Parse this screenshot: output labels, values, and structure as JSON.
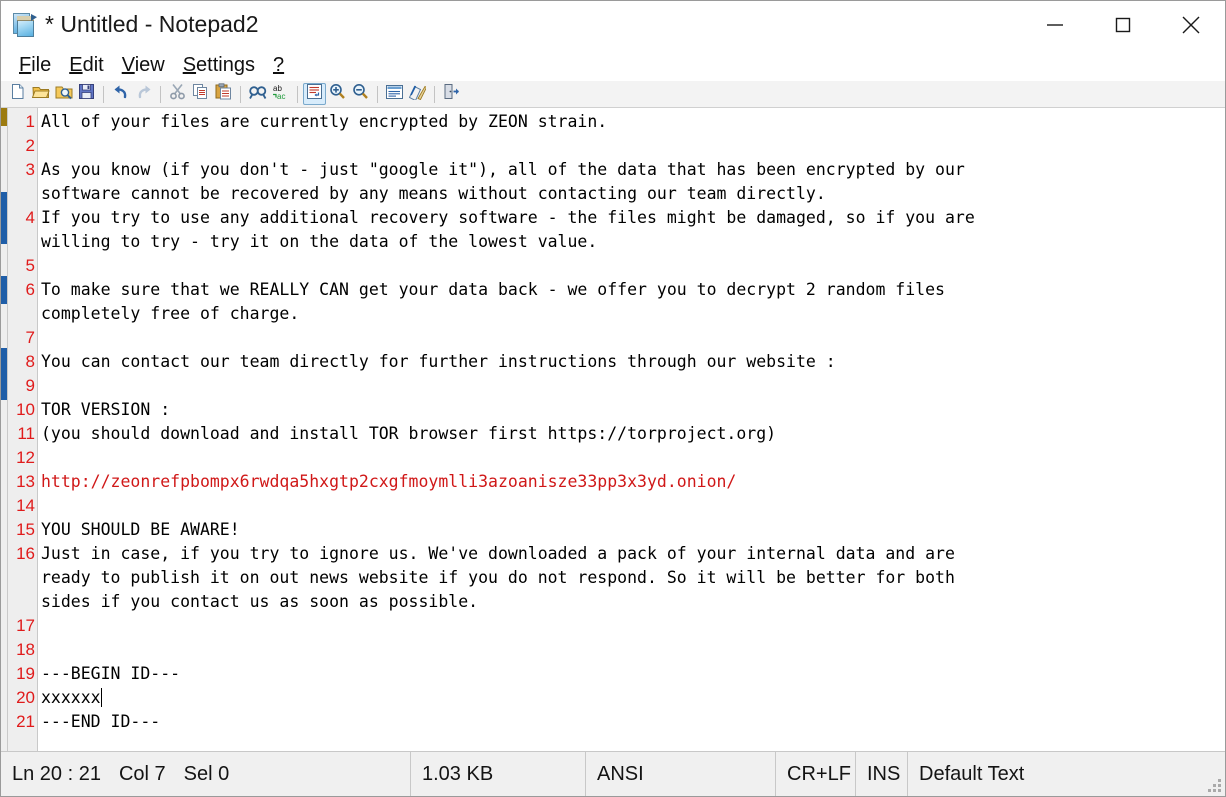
{
  "window": {
    "title": "* Untitled - Notepad2",
    "icon": "notepad-icon",
    "controls": {
      "minimize": "minimize-icon",
      "maximize": "maximize-icon",
      "close": "close-icon"
    }
  },
  "menubar": {
    "items": [
      {
        "label": "File",
        "accel": "F"
      },
      {
        "label": "Edit",
        "accel": "E"
      },
      {
        "label": "View",
        "accel": "V"
      },
      {
        "label": "Settings",
        "accel": "S"
      },
      {
        "label": "?",
        "accel": "?"
      }
    ]
  },
  "toolbar": {
    "buttons": [
      {
        "name": "new-file-icon",
        "title": "New"
      },
      {
        "name": "open-file-icon",
        "title": "Open"
      },
      {
        "name": "browse-file-icon",
        "title": "Browse"
      },
      {
        "name": "save-file-icon",
        "title": "Save"
      },
      {
        "name": "separator",
        "title": ""
      },
      {
        "name": "undo-icon",
        "title": "Undo"
      },
      {
        "name": "redo-icon",
        "title": "Redo"
      },
      {
        "name": "separator",
        "title": ""
      },
      {
        "name": "cut-icon",
        "title": "Cut"
      },
      {
        "name": "copy-icon",
        "title": "Copy"
      },
      {
        "name": "paste-icon",
        "title": "Paste"
      },
      {
        "name": "separator",
        "title": ""
      },
      {
        "name": "find-icon",
        "title": "Find"
      },
      {
        "name": "replace-icon",
        "title": "Replace"
      },
      {
        "name": "separator",
        "title": ""
      },
      {
        "name": "word-wrap-icon",
        "title": "Word Wrap",
        "active": true
      },
      {
        "name": "zoom-in-icon",
        "title": "Zoom In"
      },
      {
        "name": "zoom-out-icon",
        "title": "Zoom Out"
      },
      {
        "name": "separator",
        "title": ""
      },
      {
        "name": "scheme-icon",
        "title": "Scheme"
      },
      {
        "name": "scheme-options-icon",
        "title": "Scheme Options"
      },
      {
        "name": "separator",
        "title": ""
      },
      {
        "name": "exit-icon",
        "title": "Exit"
      }
    ]
  },
  "editor": {
    "line_numbers": [
      "1",
      "2",
      "3",
      "",
      "4",
      "",
      "5",
      "6",
      "",
      "7",
      "8",
      "9",
      "10",
      "11",
      "12",
      "13",
      "14",
      "15",
      "16",
      "",
      "",
      "17",
      "18",
      "19",
      "20",
      "21"
    ],
    "lines": [
      {
        "n": "1",
        "text": "All of your files are currently encrypted by ZEON strain."
      },
      {
        "n": "2",
        "text": ""
      },
      {
        "n": "3",
        "text": "As you know (if you don't - just \"google it\"), all of the data that has been encrypted by our"
      },
      {
        "n": "",
        "text": "software cannot be recovered by any means without contacting our team directly."
      },
      {
        "n": "4",
        "text": "If you try to use any additional recovery software - the files might be damaged, so if you are"
      },
      {
        "n": "",
        "text": "willing to try - try it on the data of the lowest value."
      },
      {
        "n": "5",
        "text": ""
      },
      {
        "n": "6",
        "text": "To make sure that we REALLY CAN get your data back - we offer you to decrypt 2 random files"
      },
      {
        "n": "",
        "text": "completely free of charge."
      },
      {
        "n": "7",
        "text": ""
      },
      {
        "n": "8",
        "text": "You can contact our team directly for further instructions through our website :"
      },
      {
        "n": "9",
        "text": ""
      },
      {
        "n": "10",
        "text": "TOR VERSION :"
      },
      {
        "n": "11",
        "text": "(you should download and install TOR browser first https://torproject.org)"
      },
      {
        "n": "12",
        "text": ""
      },
      {
        "n": "13",
        "text": "http://zeonrefpbompx6rwdqa5hxgtp2cxgfmoymlli3azoanisze33pp3x3yd.onion/",
        "style": "url"
      },
      {
        "n": "14",
        "text": ""
      },
      {
        "n": "15",
        "text": "YOU SHOULD BE AWARE!"
      },
      {
        "n": "16",
        "text": "Just in case, if you try to ignore us. We've downloaded a pack of your internal data and are"
      },
      {
        "n": "",
        "text": "ready to publish it on out news website if you do not respond. So it will be better for both"
      },
      {
        "n": "",
        "text": "sides if you contact us as soon as possible."
      },
      {
        "n": "17",
        "text": ""
      },
      {
        "n": "18",
        "text": ""
      },
      {
        "n": "19",
        "text": "---BEGIN ID---"
      },
      {
        "n": "20",
        "text": "xxxxxx",
        "caret": true
      },
      {
        "n": "21",
        "text": "---END ID---"
      }
    ],
    "url_color": "#d01818",
    "line_number_color": "#e01b1b"
  },
  "statusbar": {
    "position": "Ln 20 : 21",
    "column": "Col 7",
    "selection": "Sel 0",
    "size": "1.03 KB",
    "encoding": "ANSI",
    "line_endings": "CR+LF",
    "insert_mode": "INS",
    "scheme": "Default Text"
  }
}
